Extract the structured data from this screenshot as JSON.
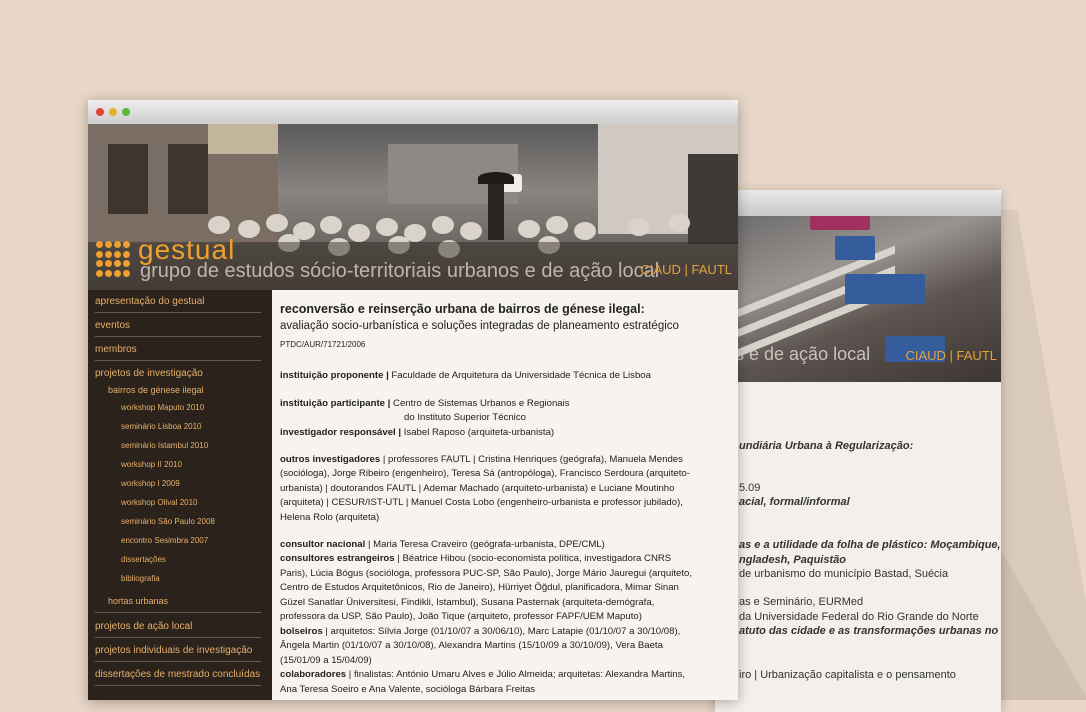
{
  "back_window": {
    "banner_tag": "os e de ação local",
    "banner_right": "CIAUD | FAUTL",
    "lines": [
      {
        "text": "undiária Urbana à Regularização:",
        "bold": true
      },
      {
        "text": "5.09",
        "bold": false
      },
      {
        "text": "acial, formal/informal",
        "bold": true
      },
      {
        "text": "as e a utilidade da folha de plástico: Moçambique,",
        "bold": true
      },
      {
        "text": "ngladesh, Paquistão",
        "bold": true
      },
      {
        "text": "de urbanismo do município Bastad, Suécia",
        "bold": false
      },
      {
        "text": "as e Seminário, EURMed",
        "bold": false
      },
      {
        "text": "da Universidade Federal do Rio Grande do Norte",
        "bold": false
      },
      {
        "text": "atuto das cidade e as transformações urbanas no",
        "bold": true
      },
      {
        "text": "iro | Urbanização capitalista e o pensamento",
        "bold": false
      }
    ]
  },
  "front_window": {
    "brand": "gestual",
    "brand_sub": "grupo de estudos sócio-territoriais urbanos e de ação local",
    "brand_right": "CIAUD | FAUTL",
    "sidebar": [
      {
        "label": "apresentação do gestual",
        "level": 0
      },
      {
        "label": "eventos",
        "level": 0
      },
      {
        "label": "membros",
        "level": 0
      },
      {
        "label": "projetos de investigação",
        "level": 0
      },
      {
        "label": "bairros de génese ilegal",
        "level": 1
      },
      {
        "label": "workshop Maputo 2010",
        "level": 2
      },
      {
        "label": "seminário Lisboa 2010",
        "level": 2
      },
      {
        "label": "seminário Istambul 2010",
        "level": 2
      },
      {
        "label": "workshop II 2010",
        "level": 2
      },
      {
        "label": "workshop I 2009",
        "level": 2
      },
      {
        "label": "workshop Olival 2010",
        "level": 2
      },
      {
        "label": "seminário São Paulo 2008",
        "level": 2
      },
      {
        "label": "encontro Sesimbra 2007",
        "level": 2
      },
      {
        "label": "dissertações",
        "level": 2
      },
      {
        "label": "bibliografia",
        "level": 2
      },
      {
        "label": "hortas urbanas",
        "level": 1
      },
      {
        "label": "projetos de ação local",
        "level": 0
      },
      {
        "label": "projetos individuais de investigação",
        "level": 0
      },
      {
        "label": "dissertações de mestrado concluídas",
        "level": 0
      }
    ],
    "main": {
      "title": "reconversão e reinserção urbana de bairros de génese ilegal:",
      "subtitle": "avaliação socio-urbanística e soluções integradas de planeamento estratégico",
      "code": "PTDC/AUR/71721/2006",
      "rows": [
        {
          "label": "instituição proponente |",
          "text": " Faculdade de Arquitetura da Universidade Técnica de Lisboa"
        },
        {
          "label": "instituição participante |",
          "text": " Centro de Sistemas Urbanos e Regionais"
        },
        {
          "label": "",
          "text": "do Instituto Superior Técnico"
        },
        {
          "label": "investigador responsável |",
          "text": " Isabel Raposo (arquiteta-urbanista)"
        },
        {
          "label": "outros investigadores",
          "text": " | professores FAUTL | Cristina Henriques (geógrafa), Manuela Mendes"
        },
        {
          "label": "",
          "text": "(socióloga), Jorge Ribeiro (engenheiro), Teresa Sá (antropóloga), Francisco Serdoura (arquiteto-"
        },
        {
          "label": "",
          "text": "urbanista) | doutorandos FAUTL | Ademar Machado (arquiteto-urbanista) e Luciane Moutinho"
        },
        {
          "label": "",
          "text": "(arquiteta) | CESUR/IST-UTL | Manuel Costa Lobo (engenheiro-urbanista e professor jubilado),"
        },
        {
          "label": "",
          "text": "Helena Rolo (arquiteta)"
        },
        {
          "label": "consultor nacional",
          "text": " | Maria Teresa Craveiro (geógrafa-urbanista, DPE/CML)"
        },
        {
          "label": "consultores estrangeiros",
          "text": " | Béatrice Hibou (socio-economista política, investigadora CNRS"
        },
        {
          "label": "",
          "text": "Paris), Lúcia Bógus (socióloga, professora PUC-SP, São Paulo), Jorge Mário Jauregui (arquiteto,"
        },
        {
          "label": "",
          "text": "Centro de Estudos Arquitetônicos, Rio de Janeiro), Hürriyet Öğdul, planificadora, Mimar Sinan"
        },
        {
          "label": "",
          "text": "Güzel Sanatlar Üniversitesi, Findikli, Istambul), Susana Pasternak (arquiteta-demógrafa,"
        },
        {
          "label": "",
          "text": "professora da USP, São Paulo), João Tique (arquiteto, professor FAPF/UEM Maputo)"
        },
        {
          "label": "bolseiros",
          "text": " | arquitetos: Sílvia Jorge (01/10/07 a 30/06/10), Marc Latapie (01/10/07 a 30/10/08),"
        },
        {
          "label": "",
          "text": "Ângela Martin (01/10/07 a 30/10/08), Alexandra Martins (15/10/09 a 30/10/09), Vera Baeta"
        },
        {
          "label": "",
          "text": "(15/01/09 a 15/04/09)"
        },
        {
          "label": "colaboradores",
          "text": " | finalistas: António Umaru Alves e Júlio Almeida; arquitetas: Alexandra Martins,"
        },
        {
          "label": "",
          "text": "Ana Teresa Soeiro e Ana Valente, socióloga Bárbara Freitas"
        }
      ]
    }
  }
}
